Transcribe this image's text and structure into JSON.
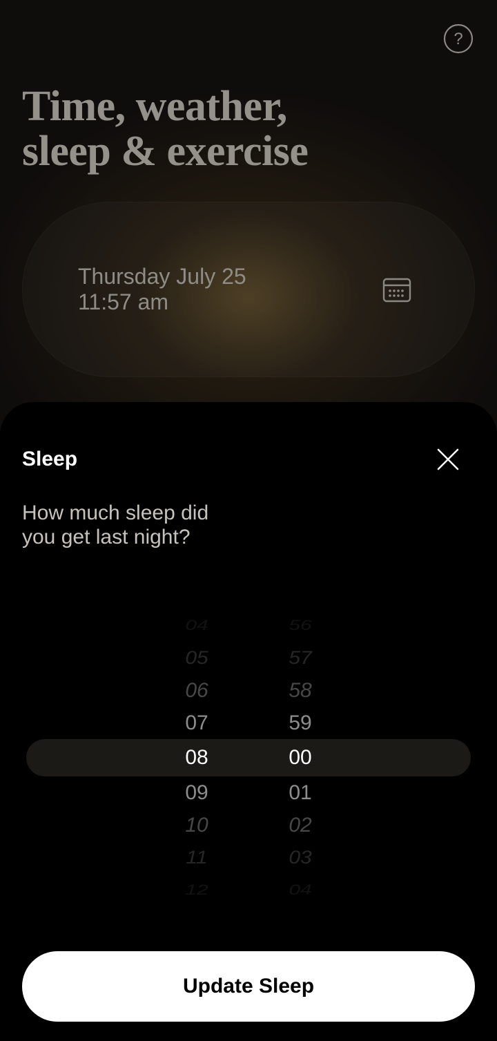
{
  "page": {
    "title_line1": "Time, weather,",
    "title_line2": "sleep & exercise"
  },
  "date_card": {
    "date": "Thursday July 25",
    "time": "11:57 am"
  },
  "sheet": {
    "title": "Sleep",
    "question": "How much sleep did you get last night?",
    "update_button_label": "Update Sleep"
  },
  "picker": {
    "hours": {
      "m4": "04",
      "m3": "05",
      "m2": "06",
      "m1": "07",
      "sel": "08",
      "p1": "09",
      "p2": "10",
      "p3": "11",
      "p4": "12"
    },
    "minutes": {
      "m4": "56",
      "m3": "57",
      "m2": "58",
      "m1": "59",
      "sel": "00",
      "p1": "01",
      "p2": "02",
      "p3": "03",
      "p4": "04"
    }
  }
}
